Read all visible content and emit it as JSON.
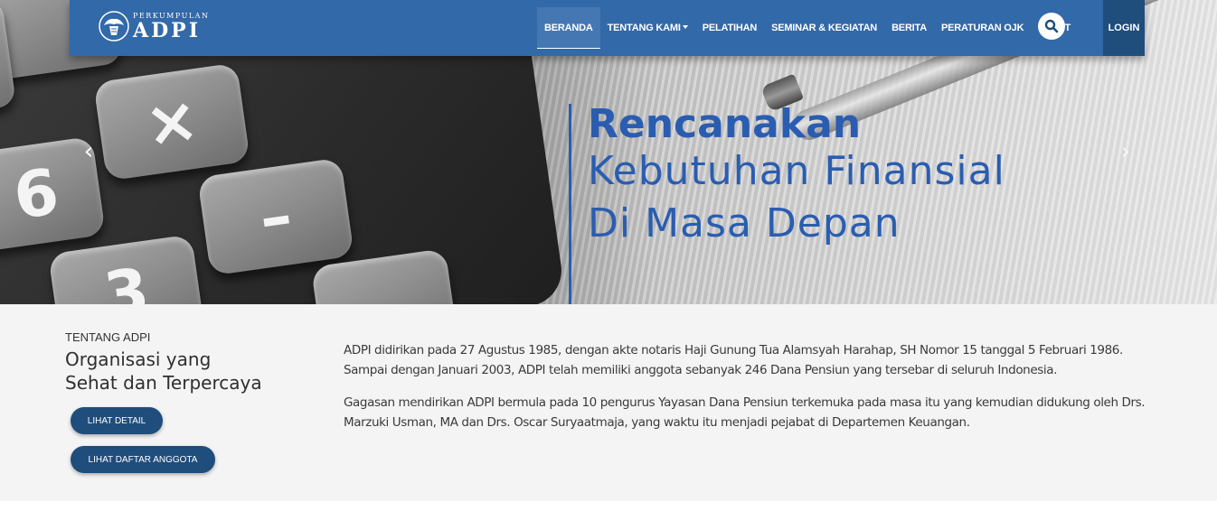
{
  "brand": {
    "logo_small": "PERKUMPULAN",
    "logo_big": "ADPI"
  },
  "nav": {
    "items": [
      {
        "label": "BERANDA",
        "active": true
      },
      {
        "label": "TENTANG KAMI",
        "dropdown": true
      },
      {
        "label": "PELATIHAN"
      },
      {
        "label": "SEMINAR & KEGIATAN"
      },
      {
        "label": "BERITA"
      },
      {
        "label": "PERATURAN OJK"
      },
      {
        "label": "EVENT"
      }
    ],
    "search_icon": "search-icon",
    "login_label": "LOGIN"
  },
  "hero": {
    "line1": "Rencanakan",
    "line2": "Kebutuhan Finansial",
    "line3": "Di Masa Depan",
    "prev_arrow": "‹",
    "next_arrow": "›"
  },
  "about": {
    "label": "TENTANG ADPI",
    "title_line1": "Organisasi yang",
    "title_line2": "Sehat dan Terpercaya",
    "btn_detail": "LIHAT DETAIL",
    "btn_anggota": "LIHAT DAFTAR ANGGOTA",
    "para1": "ADPI didirikan pada 27 Agustus 1985, dengan akte notaris Haji Gunung Tua Alamsyah Harahap, SH Nomor 15 tanggal 5 Februari 1986. Sampai dengan Januari 2003, ADPI telah memiliki anggota sebanyak 246 Dana Pensiun yang tersebar di seluruh Indonesia.",
    "para2": "Gagasan mendirikan ADPI bermula pada 10 pengurus Yayasan Dana Pensiun terkemuka pada masa itu yang kemudian didukung oleh Drs. Marzuki Usman, MA dan Drs. Oscar Suryaatmaja, yang waktu itu menjadi pejabat di Departemen Keuangan."
  },
  "colors": {
    "nav_bg": "#3269a8",
    "login_bg": "#1f4d7c",
    "accent_blue": "#2a5db0",
    "section_bg": "#f4f4f4"
  }
}
